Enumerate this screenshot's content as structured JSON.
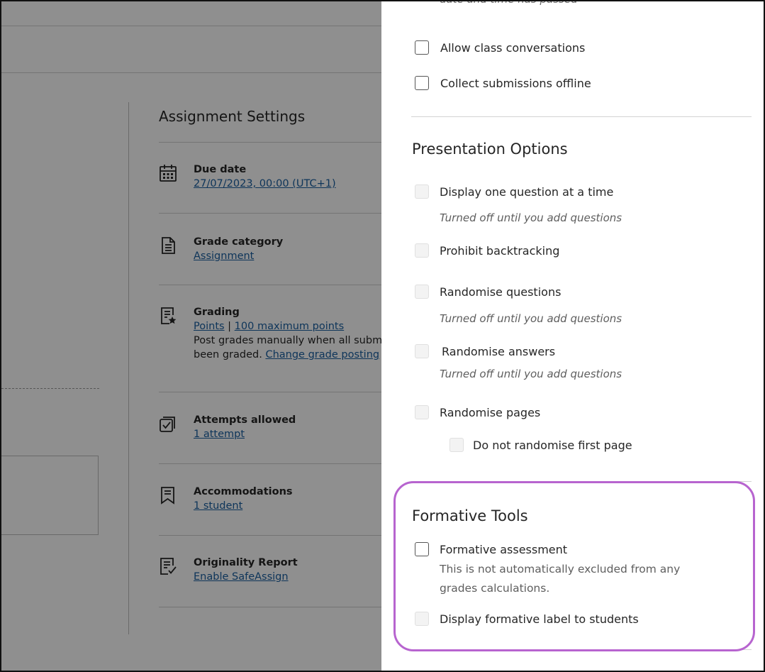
{
  "panel": {
    "top_cut_text": "date and time has passed",
    "options_top": [
      {
        "label": "Allow class conversations"
      },
      {
        "label": "Collect submissions offline"
      }
    ],
    "presentation": {
      "heading": "Presentation Options",
      "options": [
        {
          "label": "Display one question at a time",
          "note": "Turned off until you add questions"
        },
        {
          "label": "Prohibit backtracking"
        },
        {
          "label": "Randomise questions",
          "note": "Turned off until you add questions"
        },
        {
          "label": "Randomise answers",
          "note": "Turned off until you add questions"
        },
        {
          "label": "Randomise pages"
        },
        {
          "label": "Do not randomise first page"
        }
      ]
    },
    "formative": {
      "heading": "Formative Tools",
      "assessment_label": "Formative assessment",
      "assessment_desc_line1": "This is not automatically excluded from any",
      "assessment_desc_line2": "grades calculations.",
      "display_label": "Display formative label to students"
    },
    "highlight_color": "#b764cf"
  },
  "settings": {
    "title": "Assignment Settings",
    "due_date": {
      "label": "Due date",
      "value": "27/07/2023, 00:00 (UTC+1)",
      "icon": "calendar-icon"
    },
    "grade_category": {
      "label": "Grade category",
      "value": "Assignment",
      "icon": "document-icon"
    },
    "grading": {
      "label": "Grading",
      "points_link": "Points",
      "separator": " | ",
      "max_points_link": "100 maximum points",
      "line2": "Post grades manually when all submissions have",
      "line3_text": "been graded. ",
      "change_link": "Change grade posting",
      "icon": "grading-star-icon"
    },
    "attempts": {
      "label": "Attempts allowed",
      "value": "1 attempt",
      "icon": "attempts-icon"
    },
    "accommodations": {
      "label": "Accommodations",
      "value": "1 student",
      "icon": "bookmark-icon"
    },
    "originality": {
      "label": "Originality Report",
      "value": "Enable SafeAssign",
      "icon": "originality-icon"
    }
  },
  "colors": {
    "link": "#1a5fa0",
    "overlay": "rgba(0,0,0,0.44)"
  }
}
